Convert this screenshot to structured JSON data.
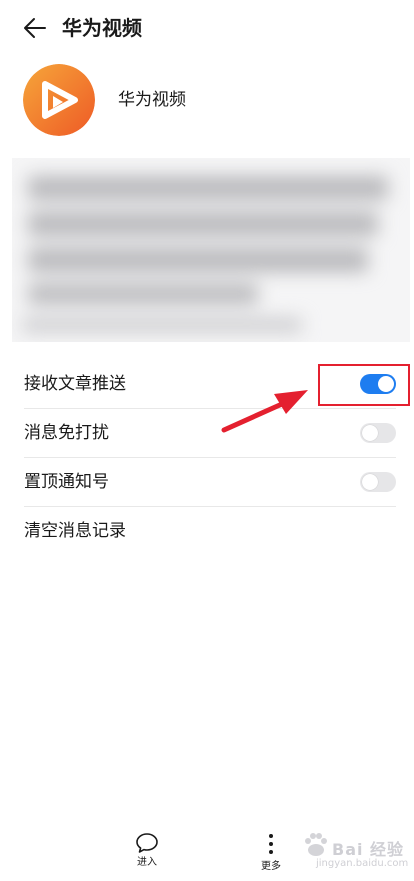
{
  "header": {
    "title": "华为视频",
    "back_icon": "arrow-left-icon"
  },
  "profile": {
    "name": "华为视频",
    "logo_icon": "huawei-video-logo",
    "logo_colors": [
      "#f6a63a",
      "#ee5a26"
    ]
  },
  "settings": [
    {
      "label": "接收文章推送",
      "type": "toggle",
      "on": true
    },
    {
      "label": "消息免打扰",
      "type": "toggle",
      "on": false
    },
    {
      "label": "置顶通知号",
      "type": "toggle",
      "on": false
    },
    {
      "label": "清空消息记录",
      "type": "action"
    }
  ],
  "bottom_nav": [
    {
      "label": "进入",
      "icon": "chat-bubble-icon"
    },
    {
      "label": "更多",
      "icon": "more-vertical-icon"
    }
  ],
  "watermark": {
    "line1": "Bai 经验",
    "line2": "jingyan.baidu.com"
  },
  "colors": {
    "accent": "#1e7df0",
    "annotation": "#e4202f",
    "toggle_off": "#e6e6e8"
  }
}
